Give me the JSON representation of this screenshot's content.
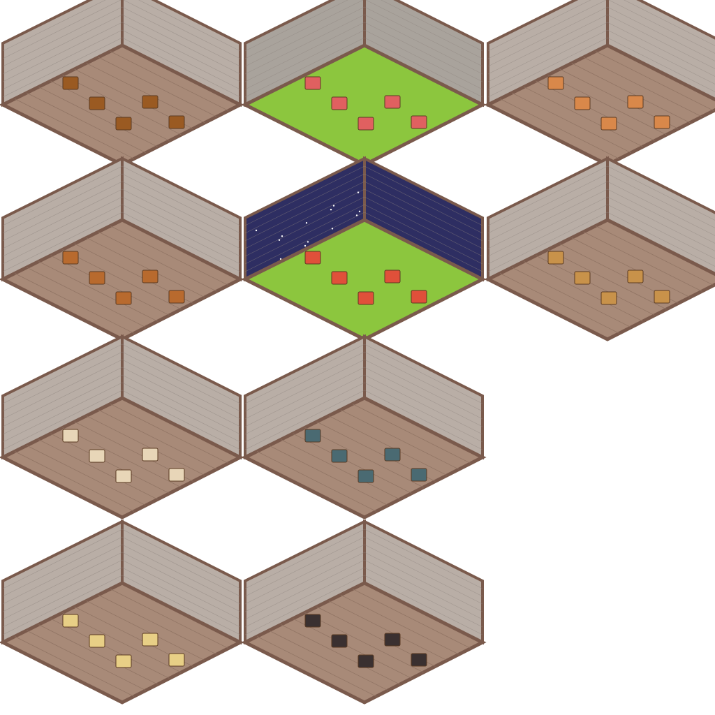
{
  "sheet": {
    "background": "#ffffff",
    "rooms": [
      {
        "theme": "library",
        "floor": "#a88a78",
        "wall": "#b9aea6",
        "accent": "#9a5a22"
      },
      {
        "theme": "garden",
        "floor": "#8cc63e",
        "wall": "#a9a39c",
        "accent": "#e06060"
      },
      {
        "theme": "concert-hall",
        "floor": "#a88a78",
        "wall": "#b9aea6",
        "accent": "#d9884a"
      },
      {
        "theme": "piano-room",
        "floor": "#a88a78",
        "wall": "#b9aea6",
        "accent": "#b86a2e"
      },
      {
        "theme": "night-garden",
        "floor": "#8cc63e",
        "wall": "#2e2e62",
        "accent": "#e0503a"
      },
      {
        "theme": "bathroom",
        "floor": "#a88a78",
        "wall": "#b9aea6",
        "accent": "#c8924a"
      },
      {
        "theme": "art-studio",
        "floor": "#a88a78",
        "wall": "#b9aea6",
        "accent": "#e8d6b8"
      },
      {
        "theme": "bedroom",
        "floor": "#a88a78",
        "wall": "#b9aea6",
        "accent": "#4a6a72"
      },
      {
        "theme": "kitchen-dining",
        "floor": "#a88a78",
        "wall": "#b9aea6",
        "accent": "#e8cf86"
      },
      {
        "theme": "bedroom-dressing",
        "floor": "#a88a78",
        "wall": "#b9aea6",
        "accent": "#3a3030"
      }
    ],
    "border_color": "#7a5a4c"
  }
}
